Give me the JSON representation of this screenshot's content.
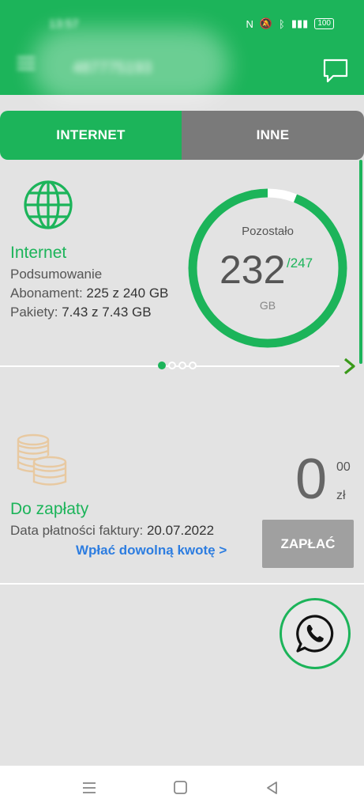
{
  "status_bar": {
    "time": "13:57",
    "battery": "100",
    "icons": [
      "nfc-icon",
      "mute-icon",
      "bluetooth-icon",
      "lte-signal-icon",
      "battery-icon"
    ]
  },
  "header": {
    "account_name": "487775193",
    "icons": [
      "menu-icon",
      "chat-icon"
    ]
  },
  "tabs": [
    {
      "label": "INTERNET",
      "active": true
    },
    {
      "label": "INNE",
      "active": false
    }
  ],
  "internet": {
    "title": "Internet",
    "summary": "Podsumowanie",
    "subscription_label": "Abonament:",
    "subscription_value": "225 z 240 GB",
    "packages_label": "Pakiety:",
    "packages_value": "7.43 z 7.43 GB",
    "ring": {
      "label": "Pozostało",
      "value": "232",
      "total": "/247",
      "unit": "GB",
      "fraction_remaining": 0.94
    },
    "pager": {
      "count": 4,
      "active_index": 0
    }
  },
  "payment": {
    "title": "Do zapłaty",
    "due_label": "Data płatności faktury:",
    "due_date": "20.07.2022",
    "amount_main": "0",
    "amount_cents": "00",
    "currency": "zł",
    "any_amount_link": "Wpłać dowolną kwotę >",
    "pay_button": "ZAPŁAĆ"
  },
  "colors": {
    "brand_green": "#1cb45a",
    "tab_inactive": "#7a7a7a",
    "link_blue": "#2d7de0",
    "button_disabled": "#a0a0a0"
  }
}
